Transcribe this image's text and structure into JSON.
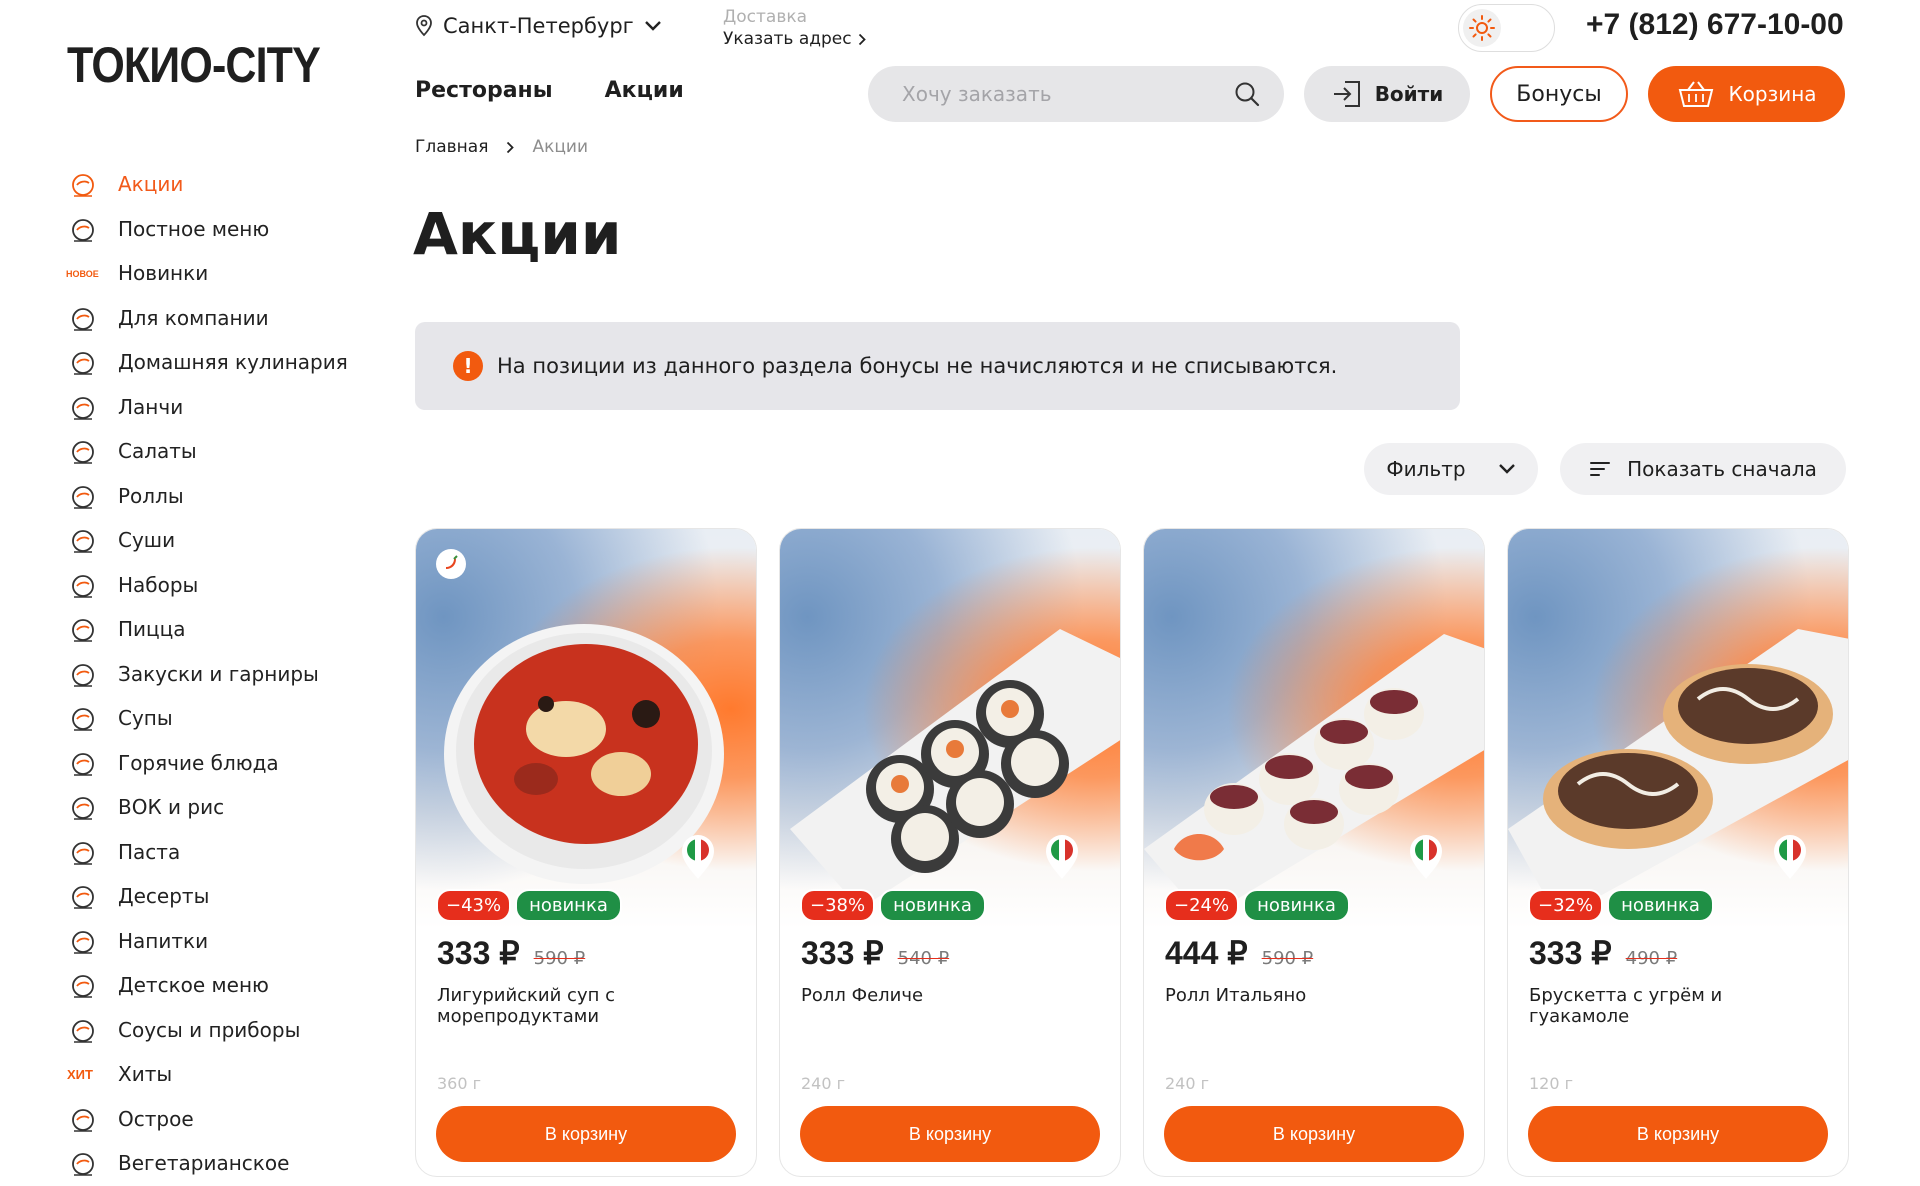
{
  "logo": "ТОКИО-CITY",
  "header": {
    "city": "Санкт-Петербург",
    "delivery_label": "Доставка",
    "delivery_address": "Указать адрес",
    "nav": [
      "Рестораны",
      "Акции"
    ],
    "phone": "+7 (812) 677-10-00",
    "search_placeholder": "Хочу заказать",
    "login": "Войти",
    "bonus": "Бонусы",
    "cart": "Корзина"
  },
  "sidebar": {
    "items": [
      {
        "label": "Акции",
        "icon": "promo-icon",
        "active": true
      },
      {
        "label": "Постное меню",
        "icon": "lent-icon"
      },
      {
        "label": "Новинки",
        "icon": "new-icon"
      },
      {
        "label": "Для компании",
        "icon": "company-icon"
      },
      {
        "label": "Домашняя кулинария",
        "icon": "home-cooking-icon"
      },
      {
        "label": "Ланчи",
        "icon": "lunch-icon"
      },
      {
        "label": "Салаты",
        "icon": "salad-icon"
      },
      {
        "label": "Роллы",
        "icon": "rolls-icon"
      },
      {
        "label": "Суши",
        "icon": "sushi-icon"
      },
      {
        "label": "Наборы",
        "icon": "sets-icon"
      },
      {
        "label": "Пицца",
        "icon": "pizza-icon"
      },
      {
        "label": "Закуски и гарниры",
        "icon": "snacks-icon"
      },
      {
        "label": "Супы",
        "icon": "soup-icon"
      },
      {
        "label": "Горячие блюда",
        "icon": "hot-dishes-icon"
      },
      {
        "label": "ВОК и рис",
        "icon": "wok-icon"
      },
      {
        "label": "Паста",
        "icon": "pasta-icon"
      },
      {
        "label": "Десерты",
        "icon": "dessert-icon"
      },
      {
        "label": "Напитки",
        "icon": "drinks-icon"
      },
      {
        "label": "Детское меню",
        "icon": "kids-icon"
      },
      {
        "label": "Соусы и приборы",
        "icon": "sauce-icon"
      },
      {
        "label": "Хиты",
        "icon": "hits-icon"
      },
      {
        "label": "Острое",
        "icon": "spicy-icon"
      },
      {
        "label": "Вегетарианское",
        "icon": "vegetarian-icon"
      }
    ]
  },
  "breadcrumb": {
    "home": "Главная",
    "current": "Акции"
  },
  "title": "Акции",
  "notice": "На позиции из данного раздела бонусы не начисляются и не списываются.",
  "controls": {
    "filter": "Фильтр",
    "sort": "Показать сначала"
  },
  "products": [
    {
      "discount": "−43%",
      "badge": "новинка",
      "price": "333 ₽",
      "old_price": "590 ₽",
      "name": "Лигурийский суп с морепродуктами",
      "weight": "360 г",
      "button": "В корзину",
      "spicy": true
    },
    {
      "discount": "−38%",
      "badge": "новинка",
      "price": "333 ₽",
      "old_price": "540 ₽",
      "name": "Ролл Феличе",
      "weight": "240 г",
      "button": "В корзину"
    },
    {
      "discount": "−24%",
      "badge": "новинка",
      "price": "444 ₽",
      "old_price": "590 ₽",
      "name": "Ролл Итальяно",
      "weight": "240 г",
      "button": "В корзину"
    },
    {
      "discount": "−32%",
      "badge": "новинка",
      "price": "333 ₽",
      "old_price": "490 ₽",
      "name": "Брускетта с угрём и гуакамоле",
      "weight": "120 г",
      "button": "В корзину"
    }
  ],
  "colors": {
    "accent": "#f25a0f",
    "discount": "#e62e1c",
    "new": "#1f8f45",
    "notice_bg": "#e6e6ea"
  }
}
